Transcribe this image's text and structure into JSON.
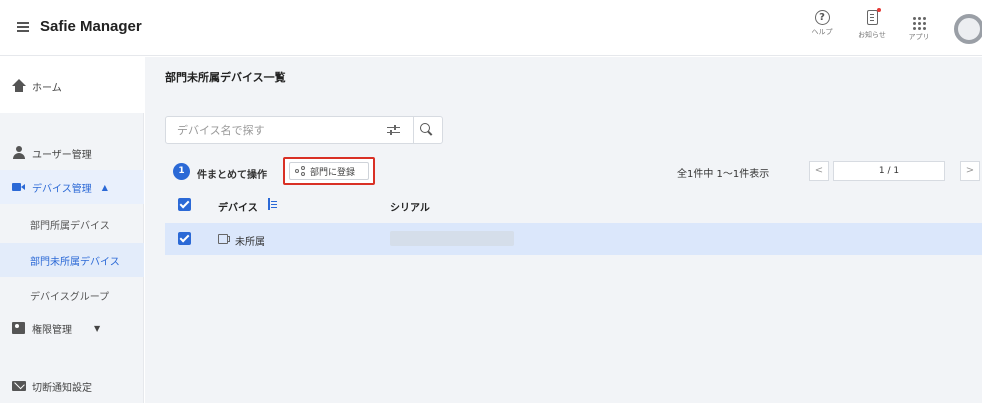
{
  "header": {
    "app_title": "Safie Manager",
    "help_label": "ヘルプ",
    "help_glyph": "?",
    "notices_label": "お知らせ",
    "apps_label": "アプリ",
    "notice_dot_color": "#e53935"
  },
  "sidebar": {
    "home": "ホーム",
    "users": "ユーザー管理",
    "devices": "デバイス管理",
    "devices_caret": "▲",
    "assigned": "部門所属デバイス",
    "unassigned": "部門未所属デバイス",
    "groups": "デバイスグループ",
    "permissions": "権限管理",
    "permissions_caret": "▼",
    "notify": "切断通知設定"
  },
  "main": {
    "title": "部門未所属デバイス一覧",
    "search_placeholder": "デバイス名で探す",
    "selected_count": "1",
    "bulk_label": "件まとめて操作",
    "register_label": "部門に登録",
    "pager_info": "全1件中 1〜1件表示",
    "page_indicator": "1 / 1",
    "prev": "<",
    "next": ">",
    "columns": {
      "device": "デバイス",
      "serial": "シリアル"
    },
    "rows": [
      {
        "device": "未所属",
        "serial_hidden": true,
        "checked": true
      }
    ]
  },
  "colors": {
    "accent": "#2b69d6",
    "highlight_border": "#d93025",
    "selected_row": "#dbe7fb"
  }
}
